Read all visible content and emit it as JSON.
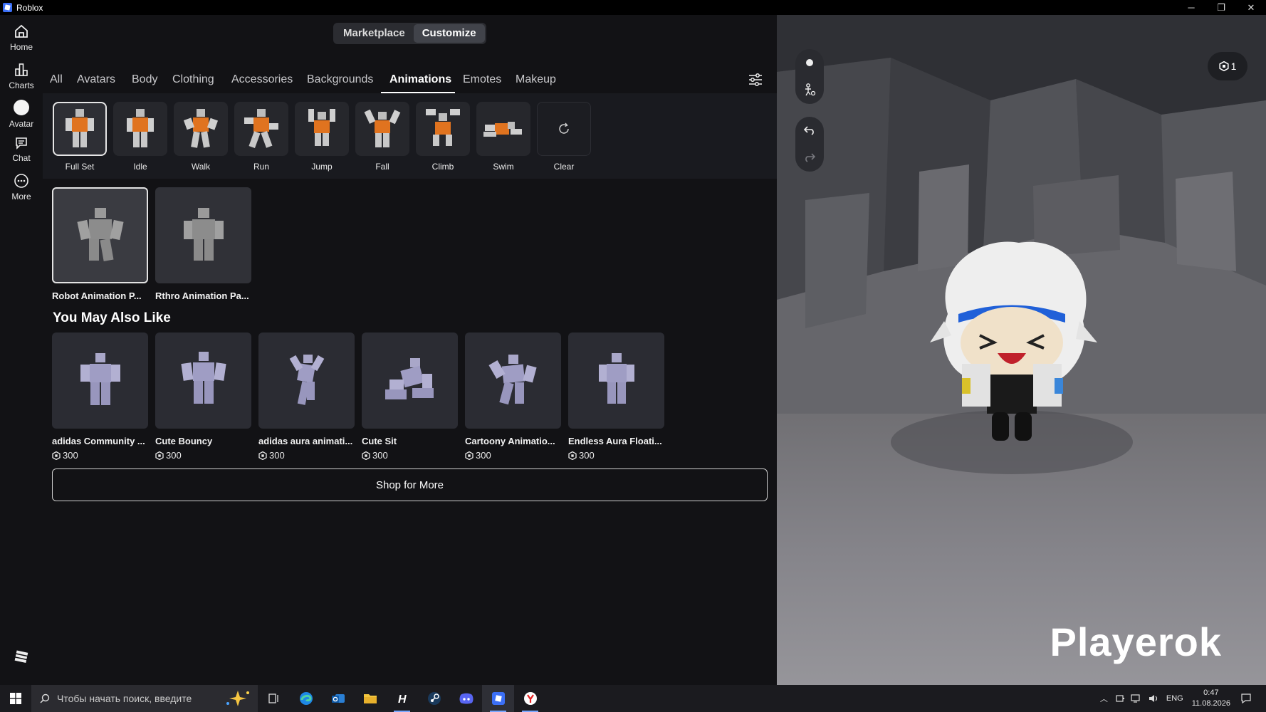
{
  "window": {
    "title": "Roblox",
    "controls": [
      "─",
      "❐",
      "✕"
    ]
  },
  "sidebar": {
    "items": [
      {
        "label": "Home",
        "icon": "home-icon"
      },
      {
        "label": "Charts",
        "icon": "charts-icon"
      },
      {
        "label": "Avatar",
        "icon": "avatar-icon"
      },
      {
        "label": "Chat",
        "icon": "chat-icon"
      },
      {
        "label": "More",
        "icon": "more-icon"
      }
    ]
  },
  "segmented": {
    "marketplace": "Marketplace",
    "customize": "Customize"
  },
  "tabs": [
    "All",
    "Avatars",
    "Body",
    "Clothing",
    "Accessories",
    "Backgrounds",
    "Animations",
    "Emotes",
    "Makeup"
  ],
  "active_tab": "Animations",
  "animation_slots": [
    {
      "label": "Full Set"
    },
    {
      "label": "Idle"
    },
    {
      "label": "Walk"
    },
    {
      "label": "Run"
    },
    {
      "label": "Jump"
    },
    {
      "label": "Fall"
    },
    {
      "label": "Climb"
    },
    {
      "label": "Swim"
    },
    {
      "label": "Clear"
    }
  ],
  "owned_packs": [
    {
      "name": "Robot Animation P..."
    },
    {
      "name": "Rthro Animation Pa..."
    }
  ],
  "recommendations": {
    "title": "You May Also Like",
    "items": [
      {
        "name": "adidas Community ...",
        "price": "300"
      },
      {
        "name": "Cute Bouncy",
        "price": "300"
      },
      {
        "name": "adidas aura animati...",
        "price": "300"
      },
      {
        "name": "Cute Sit",
        "price": "300"
      },
      {
        "name": "Cartoony Animatio...",
        "price": "300"
      },
      {
        "name": "Endless Aura Floati...",
        "price": "300"
      }
    ],
    "shop_more": "Shop for More"
  },
  "viewport": {
    "badge_count": "1",
    "watermark": "Playerok"
  },
  "taskbar": {
    "search_placeholder": "Чтобы начать поиск, введите",
    "lang": "ENG",
    "time": "0:47",
    "date": "11.08.2026"
  },
  "colors": {
    "accent_orange": "#e0731f",
    "avatar_body": "#a9a7c9",
    "panel_bg": "#121215"
  }
}
